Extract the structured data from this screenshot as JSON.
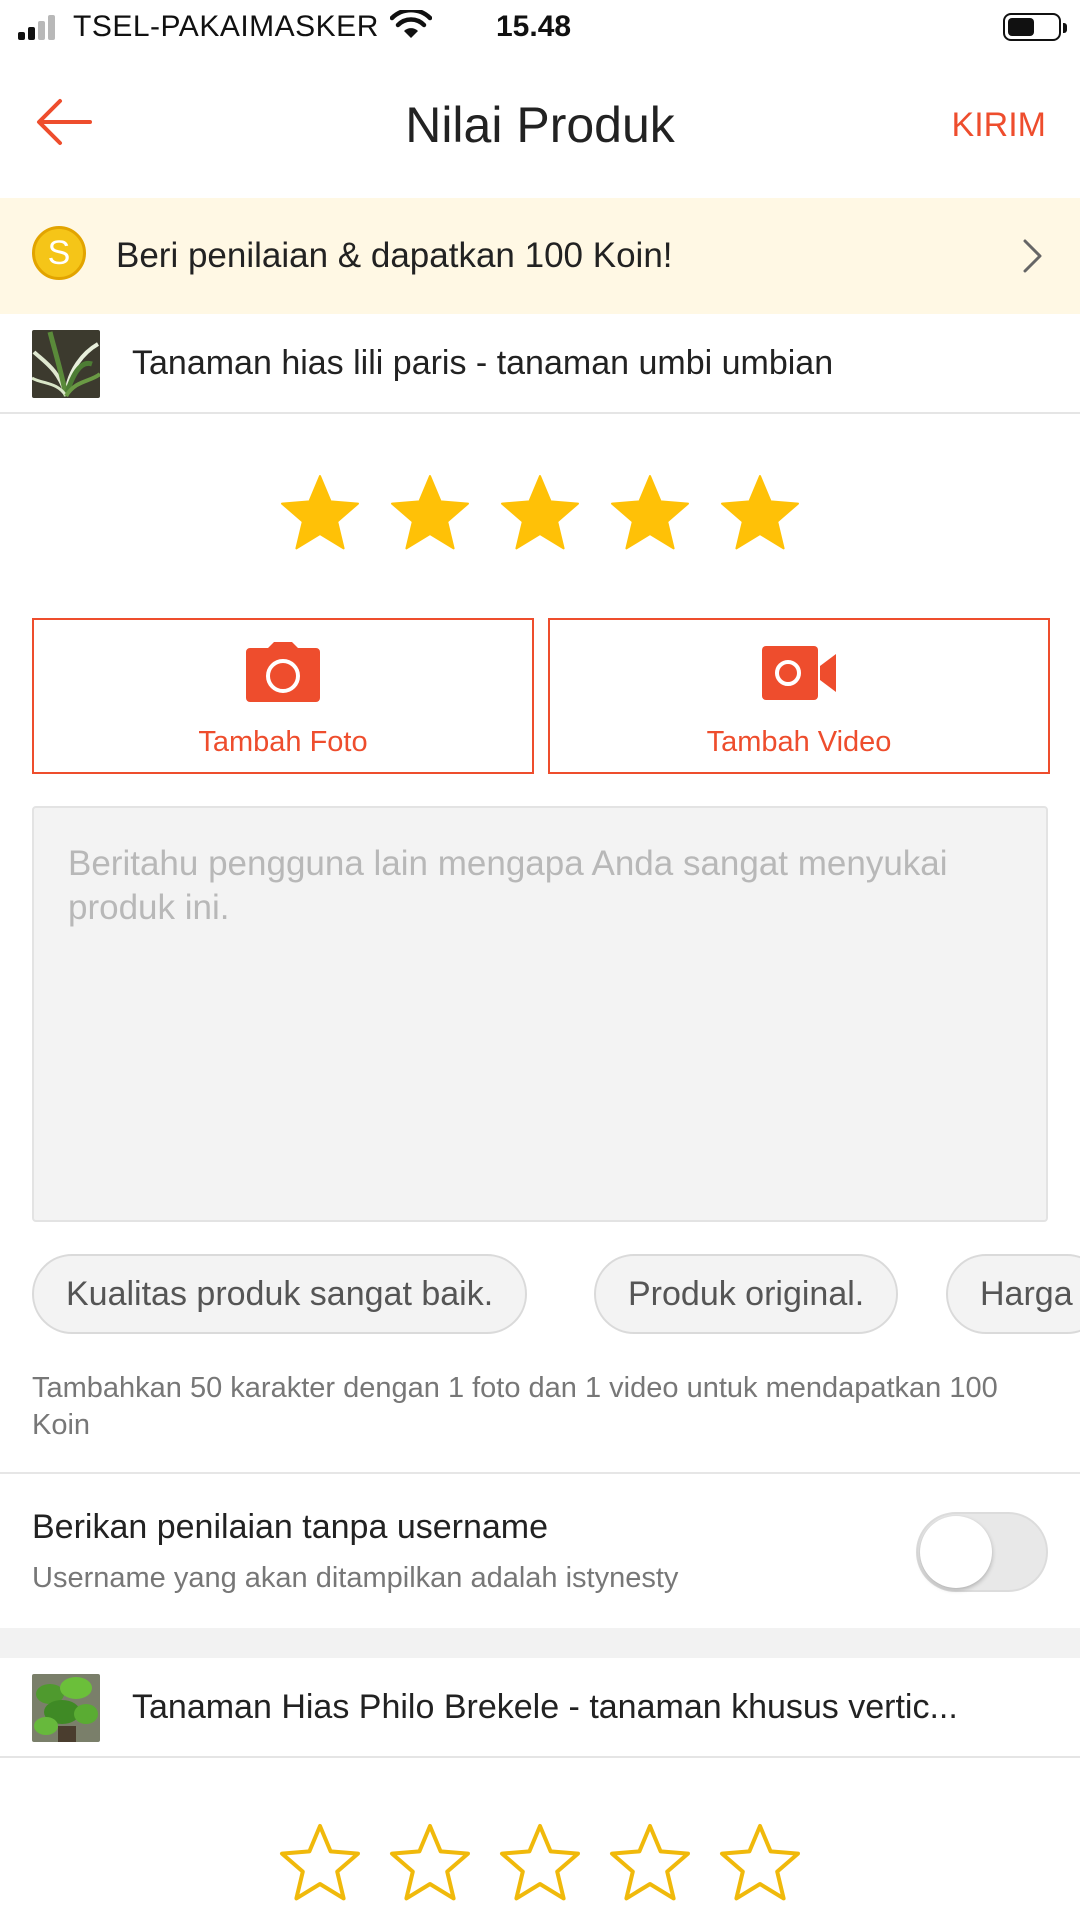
{
  "status_bar": {
    "carrier": "TSEL-PAKAIMASKER",
    "time": "15.48"
  },
  "header": {
    "title": "Nilai Produk",
    "action_label": "KIRIM"
  },
  "coin_banner": {
    "coin_symbol": "S",
    "text": "Beri penilaian & dapatkan 100 Koin!"
  },
  "products": [
    {
      "name": "Tanaman hias lili paris - tanaman umbi umbian",
      "rating": 5,
      "rating_max": 5,
      "add_photo_label": "Tambah Foto",
      "add_video_label": "Tambah Video",
      "review_placeholder": "Beritahu pengguna lain mengapa Anda sangat menyukai produk ini.",
      "quick_tags": [
        "Kualitas produk sangat baik.",
        "Produk original.",
        "Harga"
      ],
      "hint": "Tambahkan 50 karakter dengan 1 foto dan 1 video untuk mendapatkan 100 Koin",
      "anonymous": {
        "title": "Berikan penilaian tanpa username",
        "subtitle": "Username yang akan ditampilkan adalah istynesty",
        "enabled": false
      }
    },
    {
      "name": "Tanaman Hias Philo Brekele - tanaman khusus vertic...",
      "rating": 0,
      "rating_max": 5
    }
  ],
  "colors": {
    "accent": "#ee4d2d",
    "star_filled": "#ffc107",
    "star_outline": "#f0b90b",
    "banner_bg": "#fff8e4"
  }
}
